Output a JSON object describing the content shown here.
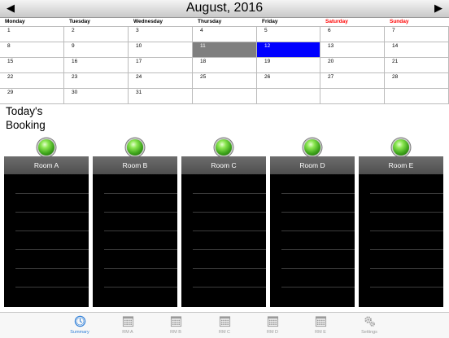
{
  "calendar": {
    "title": "August, 2016",
    "prev_label": "◀",
    "next_label": "▶",
    "weekdays": [
      "Monday",
      "Tuesday",
      "Wednesday",
      "Thursday",
      "Friday",
      "Saturday",
      "Sunday"
    ],
    "weeks": [
      [
        "1",
        "2",
        "3",
        "4",
        "5",
        "6",
        "7"
      ],
      [
        "8",
        "9",
        "10",
        "11",
        "12",
        "13",
        "14"
      ],
      [
        "15",
        "16",
        "17",
        "18",
        "19",
        "20",
        "21"
      ],
      [
        "22",
        "23",
        "24",
        "25",
        "26",
        "27",
        "28"
      ],
      [
        "29",
        "30",
        "31",
        "",
        "",
        "",
        ""
      ]
    ],
    "today": "11",
    "selected": "12",
    "colors": {
      "today": "#7f7f7f",
      "selected": "#0000ff",
      "weekend": "#ff0000"
    }
  },
  "booking": {
    "title_line1": "Today's",
    "title_line2": "Booking",
    "rooms": [
      {
        "name": "Room A",
        "status": "green"
      },
      {
        "name": "Room B",
        "status": "green"
      },
      {
        "name": "Room C",
        "status": "green"
      },
      {
        "name": "Room D",
        "status": "green"
      },
      {
        "name": "Room E",
        "status": "green"
      }
    ]
  },
  "tabbar": {
    "accent": "#2f7fd8",
    "items": [
      {
        "label": "Summary",
        "icon": "clock-icon",
        "active": true
      },
      {
        "label": "RM A",
        "icon": "calendar-icon",
        "active": false
      },
      {
        "label": "RM B",
        "icon": "calendar-icon",
        "active": false
      },
      {
        "label": "RM C",
        "icon": "calendar-icon",
        "active": false
      },
      {
        "label": "RM D",
        "icon": "calendar-icon",
        "active": false
      },
      {
        "label": "RM E",
        "icon": "calendar-icon",
        "active": false
      },
      {
        "label": "Settings",
        "icon": "gears-icon",
        "active": false
      }
    ]
  }
}
